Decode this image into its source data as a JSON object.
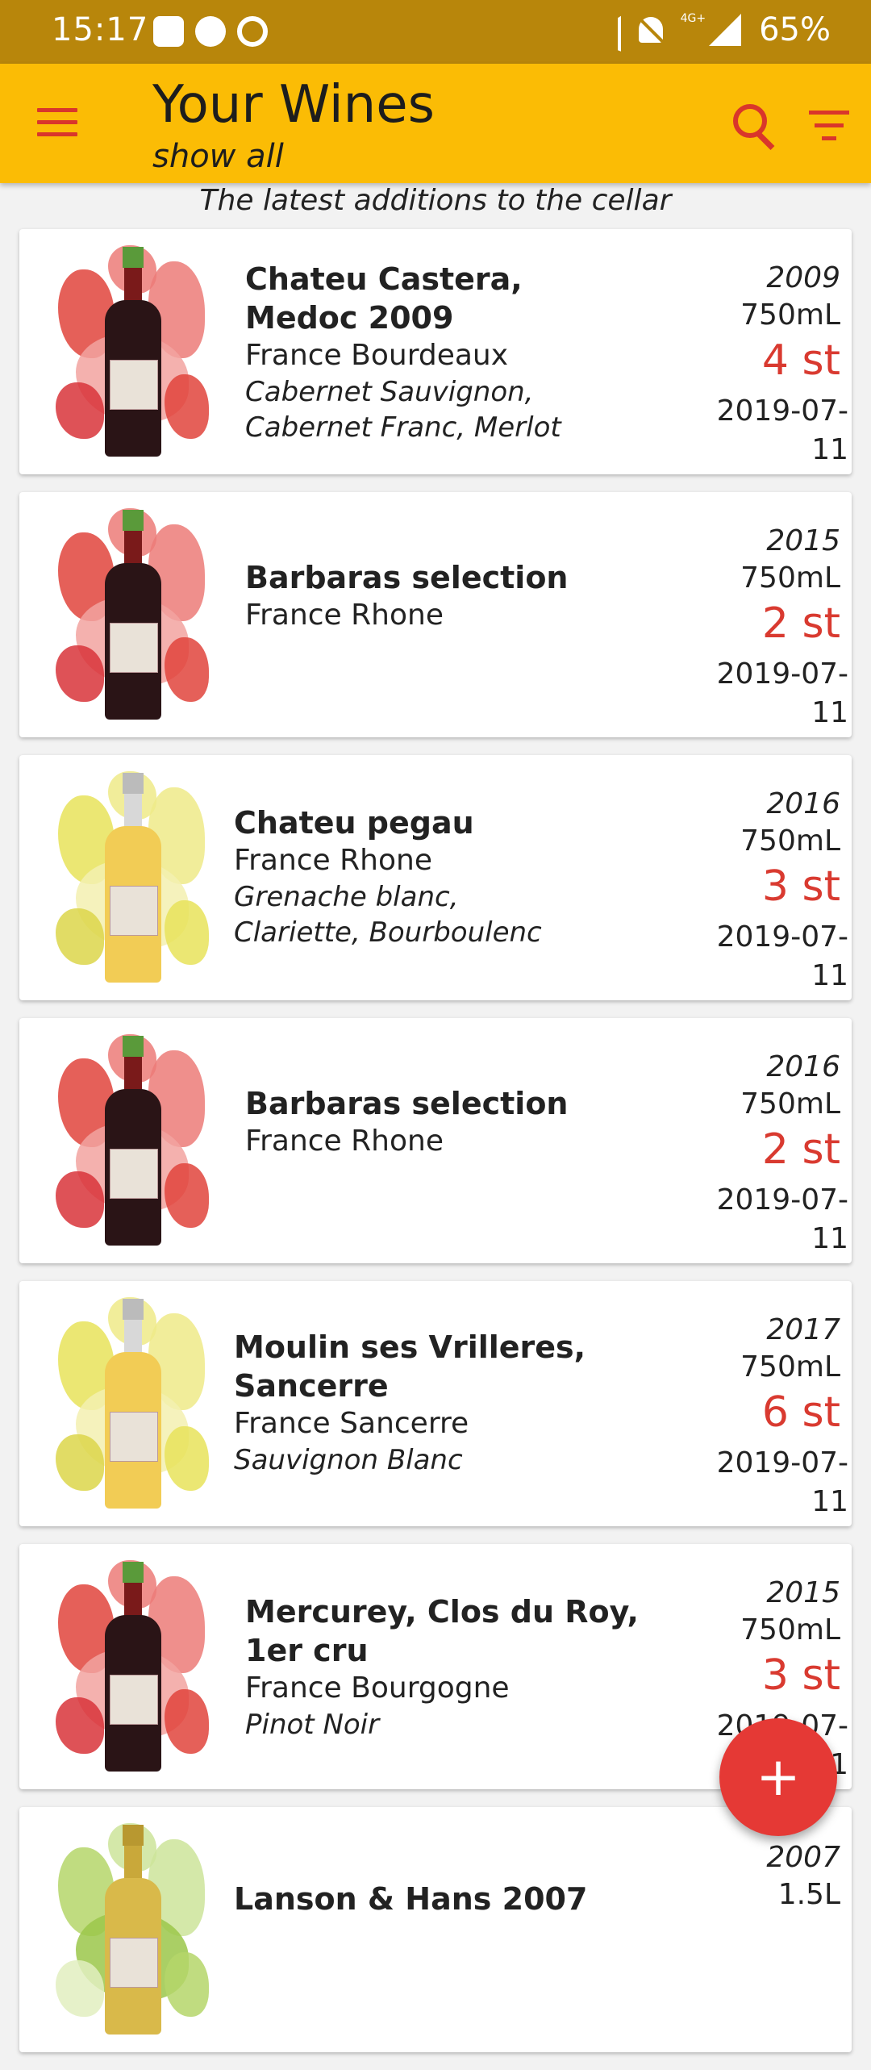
{
  "status_bar": {
    "time": "15:17",
    "network": "4G+",
    "battery": "65%"
  },
  "app_bar": {
    "title": "Your Wines",
    "subtitle": "show all",
    "icons": [
      "menu-icon",
      "search-icon",
      "filter-icon"
    ],
    "accent_color": "#fbbc05",
    "icon_color": "#d9362b"
  },
  "caption": "The latest additions to the cellar",
  "wines": [
    {
      "type": "red",
      "name_line1": "Chateu Castera,",
      "name_line2": "Medoc 2009",
      "region": "France Bourdeaux",
      "grapes_line1": "Cabernet Sauvignon,",
      "grapes_line2": "Cabernet Franc, Merlot",
      "year": "2009",
      "volume": "750mL",
      "count": "4 st",
      "date": "2019-07-11"
    },
    {
      "type": "red",
      "name_line1": "Barbaras selection",
      "name_line2": "",
      "region": "France Rhone",
      "grapes_line1": "",
      "grapes_line2": "",
      "year": "2015",
      "volume": "750mL",
      "count": "2 st",
      "date": "2019-07-11"
    },
    {
      "type": "white",
      "name_line1": "Chateu pegau",
      "name_line2": "",
      "region": "France Rhone",
      "grapes_line1": "Grenache blanc,",
      "grapes_line2": "Clariette, Bourboulenc",
      "year": "2016",
      "volume": "750mL",
      "count": "3 st",
      "date": "2019-07-11"
    },
    {
      "type": "red",
      "name_line1": "Barbaras selection",
      "name_line2": "",
      "region": "France Rhone",
      "grapes_line1": "",
      "grapes_line2": "",
      "year": "2016",
      "volume": "750mL",
      "count": "2 st",
      "date": "2019-07-11"
    },
    {
      "type": "white",
      "name_line1": "Moulin ses Vrilleres,",
      "name_line2": "Sancerre",
      "region": "France Sancerre",
      "grapes_line1": "Sauvignon Blanc",
      "grapes_line2": "",
      "year": "2017",
      "volume": "750mL",
      "count": "6 st",
      "date": "2019-07-11"
    },
    {
      "type": "red",
      "name_line1": "Mercurey, Clos du Roy,",
      "name_line2": "1er cru",
      "region": "France Bourgogne",
      "grapes_line1": "Pinot Noir",
      "grapes_line2": "",
      "year": "2015",
      "volume": "750mL",
      "count": "3 st",
      "date": "2019-07-11"
    },
    {
      "type": "sparkling",
      "name_line1": "Lanson & Hans 2007",
      "name_line2": "",
      "region": "",
      "grapes_line1": "",
      "grapes_line2": "",
      "year": "2007",
      "volume": "1.5L",
      "count": "",
      "date": ""
    }
  ],
  "fab": {
    "label": "+",
    "icon": "plus-icon",
    "color": "#e53935"
  }
}
